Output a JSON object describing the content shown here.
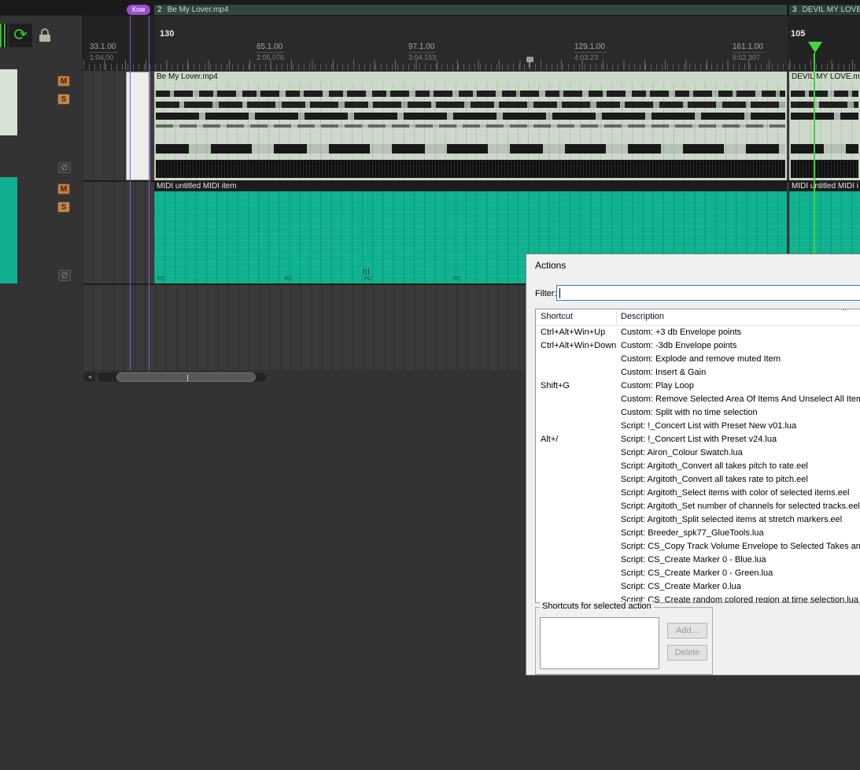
{
  "topbar": {
    "marker": {
      "label": "Ком"
    },
    "regions": [
      {
        "num": "2",
        "name": "Be My Lover.mp4"
      },
      {
        "num": "3",
        "name": "DEVIL MY LOVE."
      }
    ]
  },
  "ruler": {
    "tempo_markers": [
      "130",
      "105"
    ],
    "measures": [
      {
        "bar": "33.1.00",
        "time": "1:04.00"
      },
      {
        "bar": "65.1.00",
        "time": "2:05.076"
      },
      {
        "bar": "97.1.00",
        "time": "3:04.153"
      },
      {
        "bar": "129.1.00",
        "time": "4:03.23"
      },
      {
        "bar": "161.1.00",
        "time": "5:02.307"
      }
    ]
  },
  "tracks": {
    "track1": {
      "mute": "M",
      "solo": "S",
      "phase": "∅"
    },
    "track2": {
      "mute": "M",
      "solo": "S",
      "phase": "∅"
    },
    "items": {
      "audio_main": "Be My Lover.mp4",
      "audio_right": "DEVIL MY LOVE.mp",
      "midi_main": "MIDI untitled MIDI item",
      "midi_right": "MIDI untitled MIDI i"
    },
    "pc_marks": [
      "PC",
      "PC",
      "PC",
      "PC"
    ]
  },
  "scrollbar": {
    "left_arrow": "◂"
  },
  "toolbar": {
    "loop_icon": "⟳"
  },
  "colors": {
    "midi_teal": "#10b290",
    "item_sage": "#ccd8ca",
    "marker_purple": "#9a4fd0",
    "play_cursor_green": "#3bd63b"
  },
  "actions_dialog": {
    "title": "Actions",
    "filter_label": "Filter:",
    "filter_value": "",
    "columns": {
      "shortcut": "Shortcut",
      "description": "Description"
    },
    "sort_icon": "^",
    "rows": [
      {
        "shortcut": "Ctrl+Alt+Win+Up",
        "description": "Custom: +3 db Envelope points"
      },
      {
        "shortcut": "Ctrl+Alt+Win+Down",
        "description": "Custom: -3db Envelope points"
      },
      {
        "shortcut": "",
        "description": "Custom: Explode and remove muted Item"
      },
      {
        "shortcut": "",
        "description": "Custom: Insert & Gain"
      },
      {
        "shortcut": "Shift+G",
        "description": "Custom: Play Loop"
      },
      {
        "shortcut": "",
        "description": "Custom: Remove Selected Area Of Items And Unselect All Items"
      },
      {
        "shortcut": "",
        "description": "Custom: Split with no time selection"
      },
      {
        "shortcut": "",
        "description": "Script: !_Concert List with Preset New v01.lua"
      },
      {
        "shortcut": "Alt+/",
        "description": "Script: !_Concert List with Preset v24.lua"
      },
      {
        "shortcut": "",
        "description": "Script: Airon_Colour Swatch.lua"
      },
      {
        "shortcut": "",
        "description": "Script: Argitoth_Convert all takes pitch to rate.eel"
      },
      {
        "shortcut": "",
        "description": "Script: Argitoth_Convert all takes rate to pitch.eel"
      },
      {
        "shortcut": "",
        "description": "Script: Argitoth_Select items with color of selected items.eel"
      },
      {
        "shortcut": "",
        "description": "Script: Argitoth_Set number of channels for selected tracks.eel"
      },
      {
        "shortcut": "",
        "description": "Script: Argitoth_Split selected items at stretch markers.eel"
      },
      {
        "shortcut": "",
        "description": "Script: Breeder_spk77_GlueTools.lua"
      },
      {
        "shortcut": "",
        "description": "Script: CS_Copy Track Volume Envelope to Selected Takes and"
      },
      {
        "shortcut": "",
        "description": "Script: CS_Create Marker 0 - Blue.lua"
      },
      {
        "shortcut": "",
        "description": "Script: CS_Create Marker 0 - Green.lua"
      },
      {
        "shortcut": "",
        "description": "Script: CS_Create Marker 0.lua"
      },
      {
        "shortcut": "",
        "description": "Script: CS_Create random colored region at time selection.lua"
      }
    ],
    "group": {
      "label": "Shortcuts for selected action",
      "add_button": "Add...",
      "delete_button": "Delete"
    }
  }
}
